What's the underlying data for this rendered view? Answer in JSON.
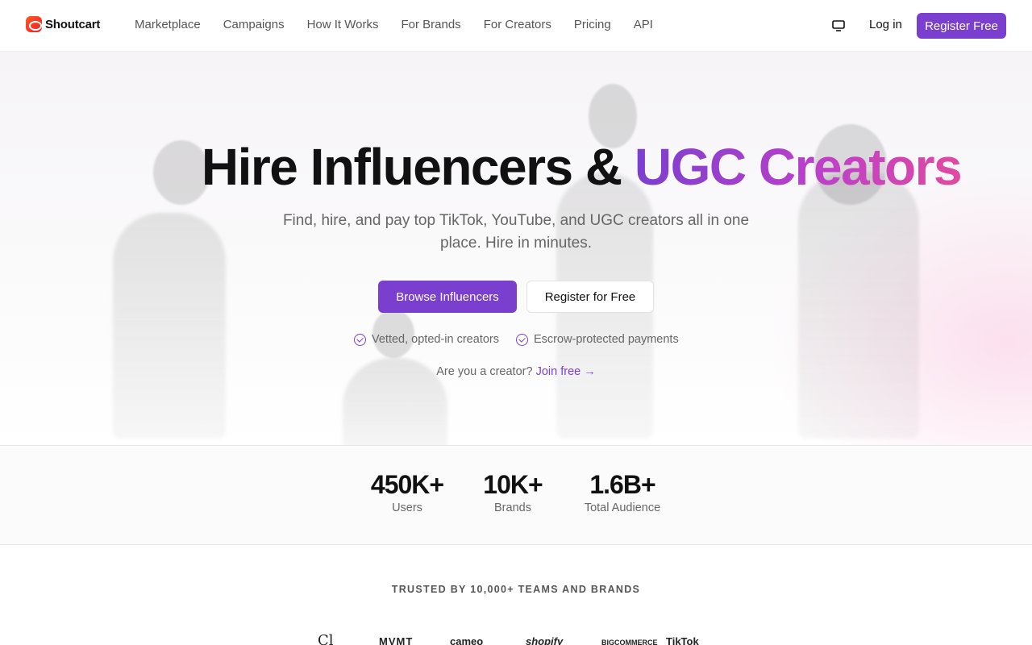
{
  "header": {
    "logo_text": "Shoutcart",
    "nav": [
      "Marketplace",
      "Campaigns",
      "How It Works",
      "For Brands",
      "For Creators",
      "Pricing",
      "API"
    ],
    "login_label": "Log in",
    "register_label": "Register Free"
  },
  "hero": {
    "title_main": "Hire Influencers & ",
    "title_accent": "UGC Creators",
    "subtitle": "Find, hire, and pay top TikTok, YouTube, and UGC creators all in one place. Hire in minutes.",
    "primary_button": "Browse Influencers",
    "secondary_button": "Register for Free",
    "checks": [
      "Vetted, opted-in creators",
      "Escrow-protected payments"
    ],
    "creator_prompt": "Are you a creator?",
    "creator_link": "Join free →"
  },
  "stats": [
    {
      "value": "450K+",
      "label": "Users"
    },
    {
      "value": "10K+",
      "label": "Brands"
    },
    {
      "value": "1.6B+",
      "label": "Total Audience"
    }
  ],
  "trusted": {
    "heading": "TRUSTED BY 10,000+ TEAMS AND BRANDS",
    "brands": [
      "Cl",
      "MVMT",
      "cameo",
      "shopify",
      "BIGCOMMERCE",
      "TikTok"
    ]
  },
  "colors": {
    "accent": "#7b3fd0",
    "gradient_end": "#e04aa0"
  }
}
